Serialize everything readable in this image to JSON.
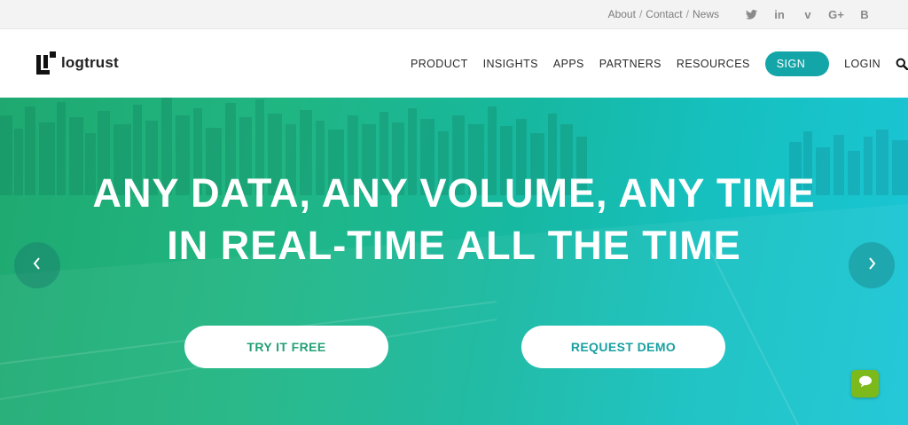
{
  "topbar": {
    "links": [
      "About",
      "Contact",
      "News"
    ],
    "separator": "/",
    "social": [
      {
        "icon": "twitter-icon"
      },
      {
        "icon": "linkedin-icon",
        "glyph": "in"
      },
      {
        "icon": "vimeo-icon",
        "glyph": "v"
      },
      {
        "icon": "google-plus-icon",
        "glyph": "G+"
      },
      {
        "icon": "blog-icon",
        "glyph": "B"
      }
    ]
  },
  "header": {
    "logo_text": "logtrust",
    "nav": [
      "PRODUCT",
      "INSIGHTS",
      "APPS",
      "PARTNERS",
      "RESOURCES"
    ],
    "signup": "SIGN UP",
    "login": "LOGIN",
    "search_icon": "search-icon"
  },
  "hero": {
    "headline_line1": "ANY DATA, ANY VOLUME, ANY TIME",
    "headline_line2": "IN REAL-TIME ALL THE TIME",
    "try_button": "TRY IT FREE",
    "demo_button": "REQUEST DEMO",
    "prev_icon": "chevron-left-icon",
    "next_icon": "chevron-right-icon",
    "chat_icon": "chat-bubble-icon"
  },
  "colors": {
    "accent": "#14a5a8",
    "hero_start": "#1fa970",
    "hero_end": "#1ac6d6",
    "chat": "#7cb91a"
  }
}
